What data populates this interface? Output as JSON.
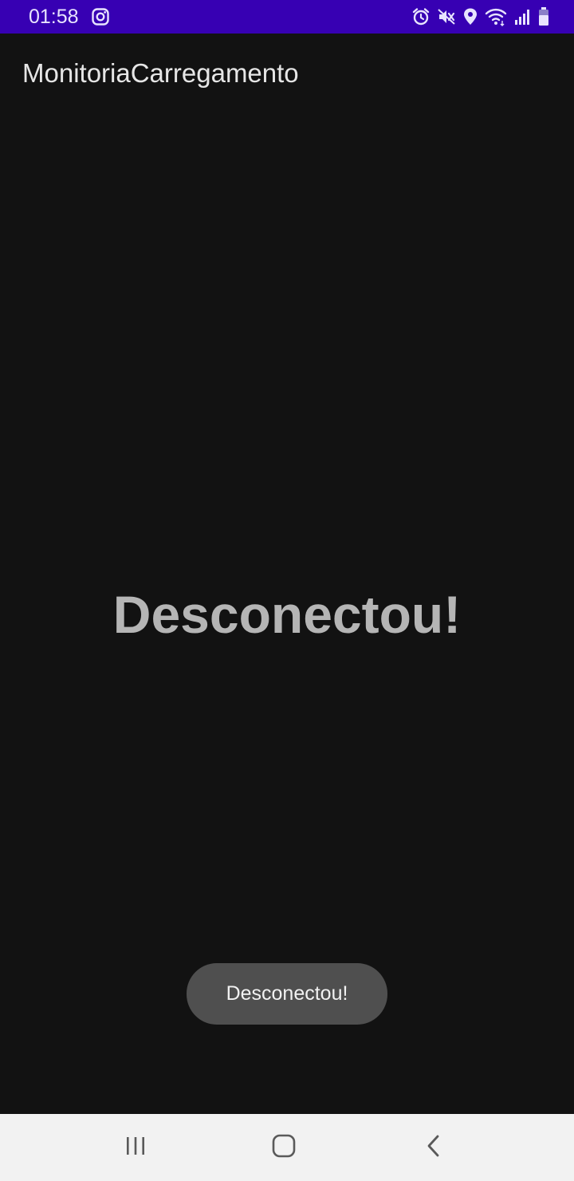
{
  "status_bar": {
    "time": "01:58",
    "background_color": "#3700b3",
    "icons": [
      "instagram-icon",
      "alarm-icon",
      "mute-icon",
      "location-icon",
      "wifi-icon",
      "signal-icon",
      "battery-icon"
    ]
  },
  "app_bar": {
    "title": "MonitoriaCarregamento"
  },
  "main": {
    "status_text": "Desconectou!"
  },
  "toast": {
    "message": "Desconectou!"
  },
  "nav_bar": {
    "buttons": [
      "recents-icon",
      "home-icon",
      "back-icon"
    ]
  }
}
